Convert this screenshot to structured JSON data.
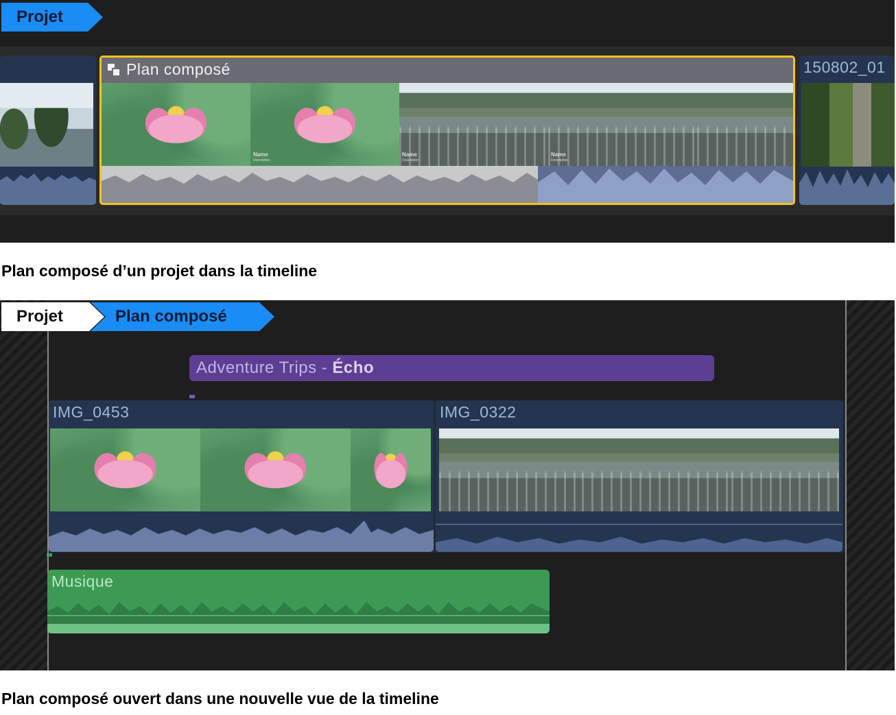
{
  "top_panel": {
    "breadcrumb": {
      "project_label": "Projet"
    },
    "compound_clip": {
      "title": "Plan composé"
    },
    "thumbnail_overlay": {
      "name": "Name",
      "description": "Description"
    },
    "next_clip": {
      "title": "150802_01"
    },
    "caption": "Plan composé d’un projet dans la timeline"
  },
  "bottom_panel": {
    "breadcrumb": {
      "project_label": "Projet",
      "compound_label": "Plan composé"
    },
    "title_clip": {
      "name": "Adventure Trips - ",
      "effect": "Écho"
    },
    "clips": [
      {
        "title": "IMG_0453"
      },
      {
        "title": "IMG_0322"
      }
    ],
    "audio_clip": {
      "title": "Musique"
    },
    "caption": "Plan composé ouvert dans une nouvelle vue de la timeline"
  },
  "colors": {
    "timeline_bg": "#1e1e1e",
    "breadcrumb_active": "#1a8cf5",
    "selection_outline": "#f2c51a",
    "video_clip": "#24354f",
    "title_clip": "#5c3e93",
    "audio_clip": "#3d9a55"
  }
}
